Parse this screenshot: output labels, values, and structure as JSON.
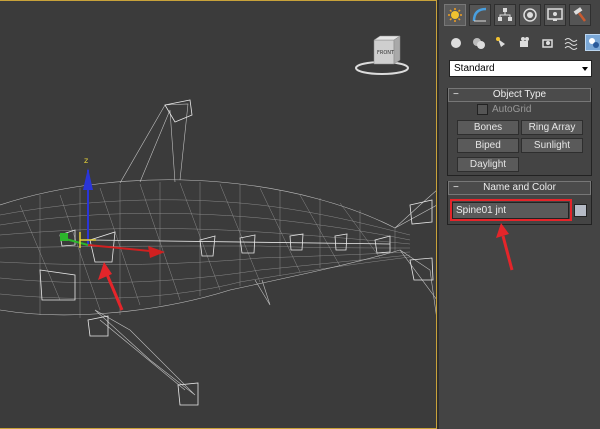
{
  "viewport": {
    "viewcube_label": "FRONT"
  },
  "command_panel": {
    "tabs": [
      {
        "name": "create-tab-icon",
        "active": true
      },
      {
        "name": "modify-tab-icon",
        "active": false
      },
      {
        "name": "hierarchy-tab-icon",
        "active": false
      },
      {
        "name": "motion-tab-icon",
        "active": false
      },
      {
        "name": "display-tab-icon",
        "active": false
      },
      {
        "name": "utilities-tab-icon",
        "active": false
      }
    ],
    "category_icons": [
      "geometry-icon",
      "shapes-icon",
      "lights-icon",
      "cameras-icon",
      "helpers-icon",
      "spacewarps-icon",
      "systems-icon"
    ],
    "dropdown_value": "Standard",
    "object_type": {
      "title": "Object Type",
      "autogrid_label": "AutoGrid",
      "buttons": [
        "Bones",
        "Ring Array",
        "Biped",
        "Sunlight",
        "Daylight"
      ]
    },
    "name_and_color": {
      "title": "Name and Color",
      "name_value": "Spine01 jnt",
      "swatch_color": "#b6bbc6"
    }
  },
  "colors": {
    "highlight": "#e4252a",
    "viewport_border": "#c8a23a",
    "wire": "#cfcfcf"
  }
}
